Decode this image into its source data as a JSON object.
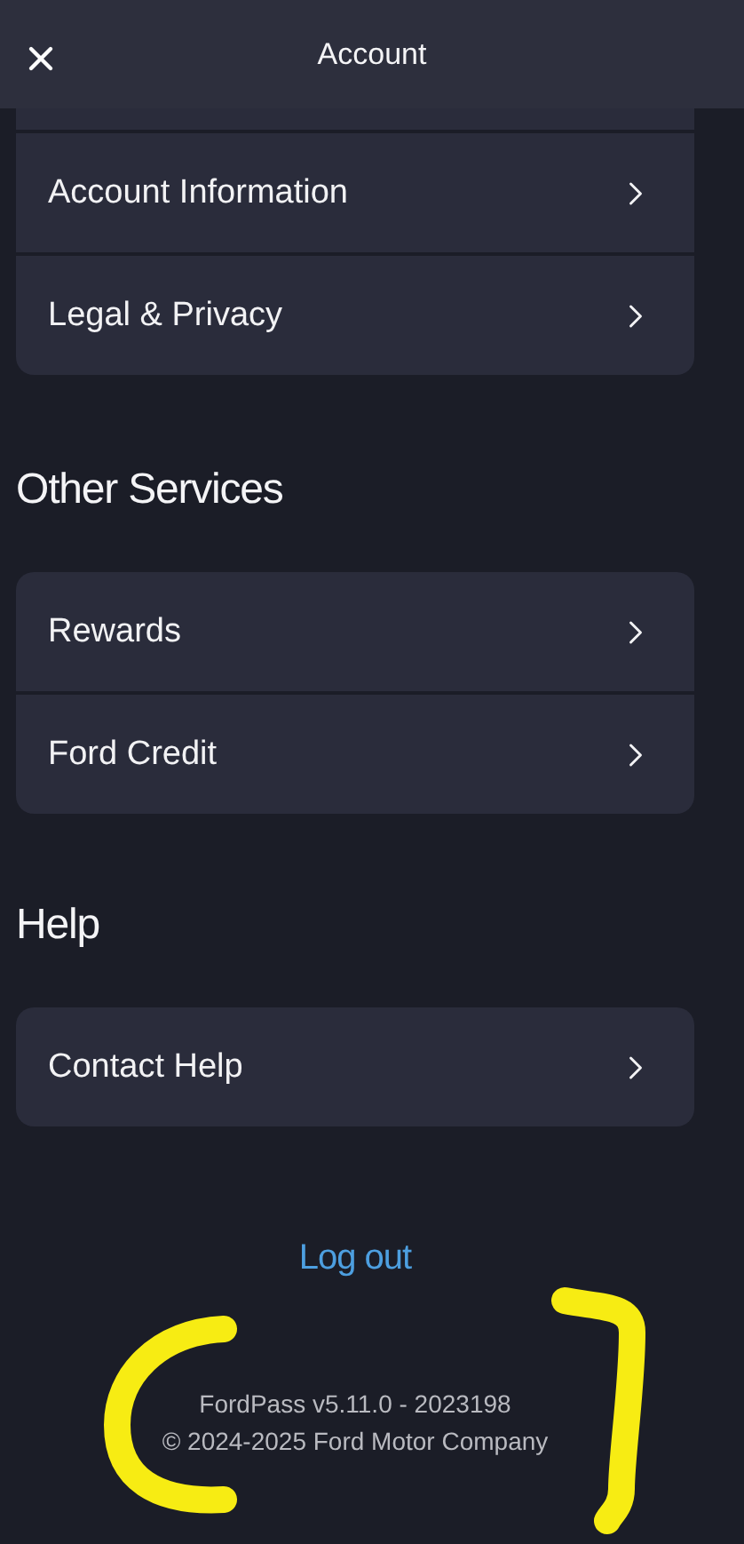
{
  "header": {
    "title": "Account"
  },
  "sections": [
    {
      "cut_off_row": true,
      "items": [
        {
          "label": "Account Information"
        },
        {
          "label": "Legal & Privacy"
        }
      ]
    },
    {
      "heading": "Other Services",
      "cut_off_row": false,
      "items": [
        {
          "label": "Rewards"
        },
        {
          "label": "Ford Credit"
        }
      ]
    },
    {
      "heading": "Help",
      "cut_off_row": false,
      "items": [
        {
          "label": "Contact Help"
        }
      ]
    }
  ],
  "logout": "Log out",
  "footer": [
    "FordPass v5.11.0 - 2023198",
    "© 2024-2025 Ford Motor Company"
  ]
}
